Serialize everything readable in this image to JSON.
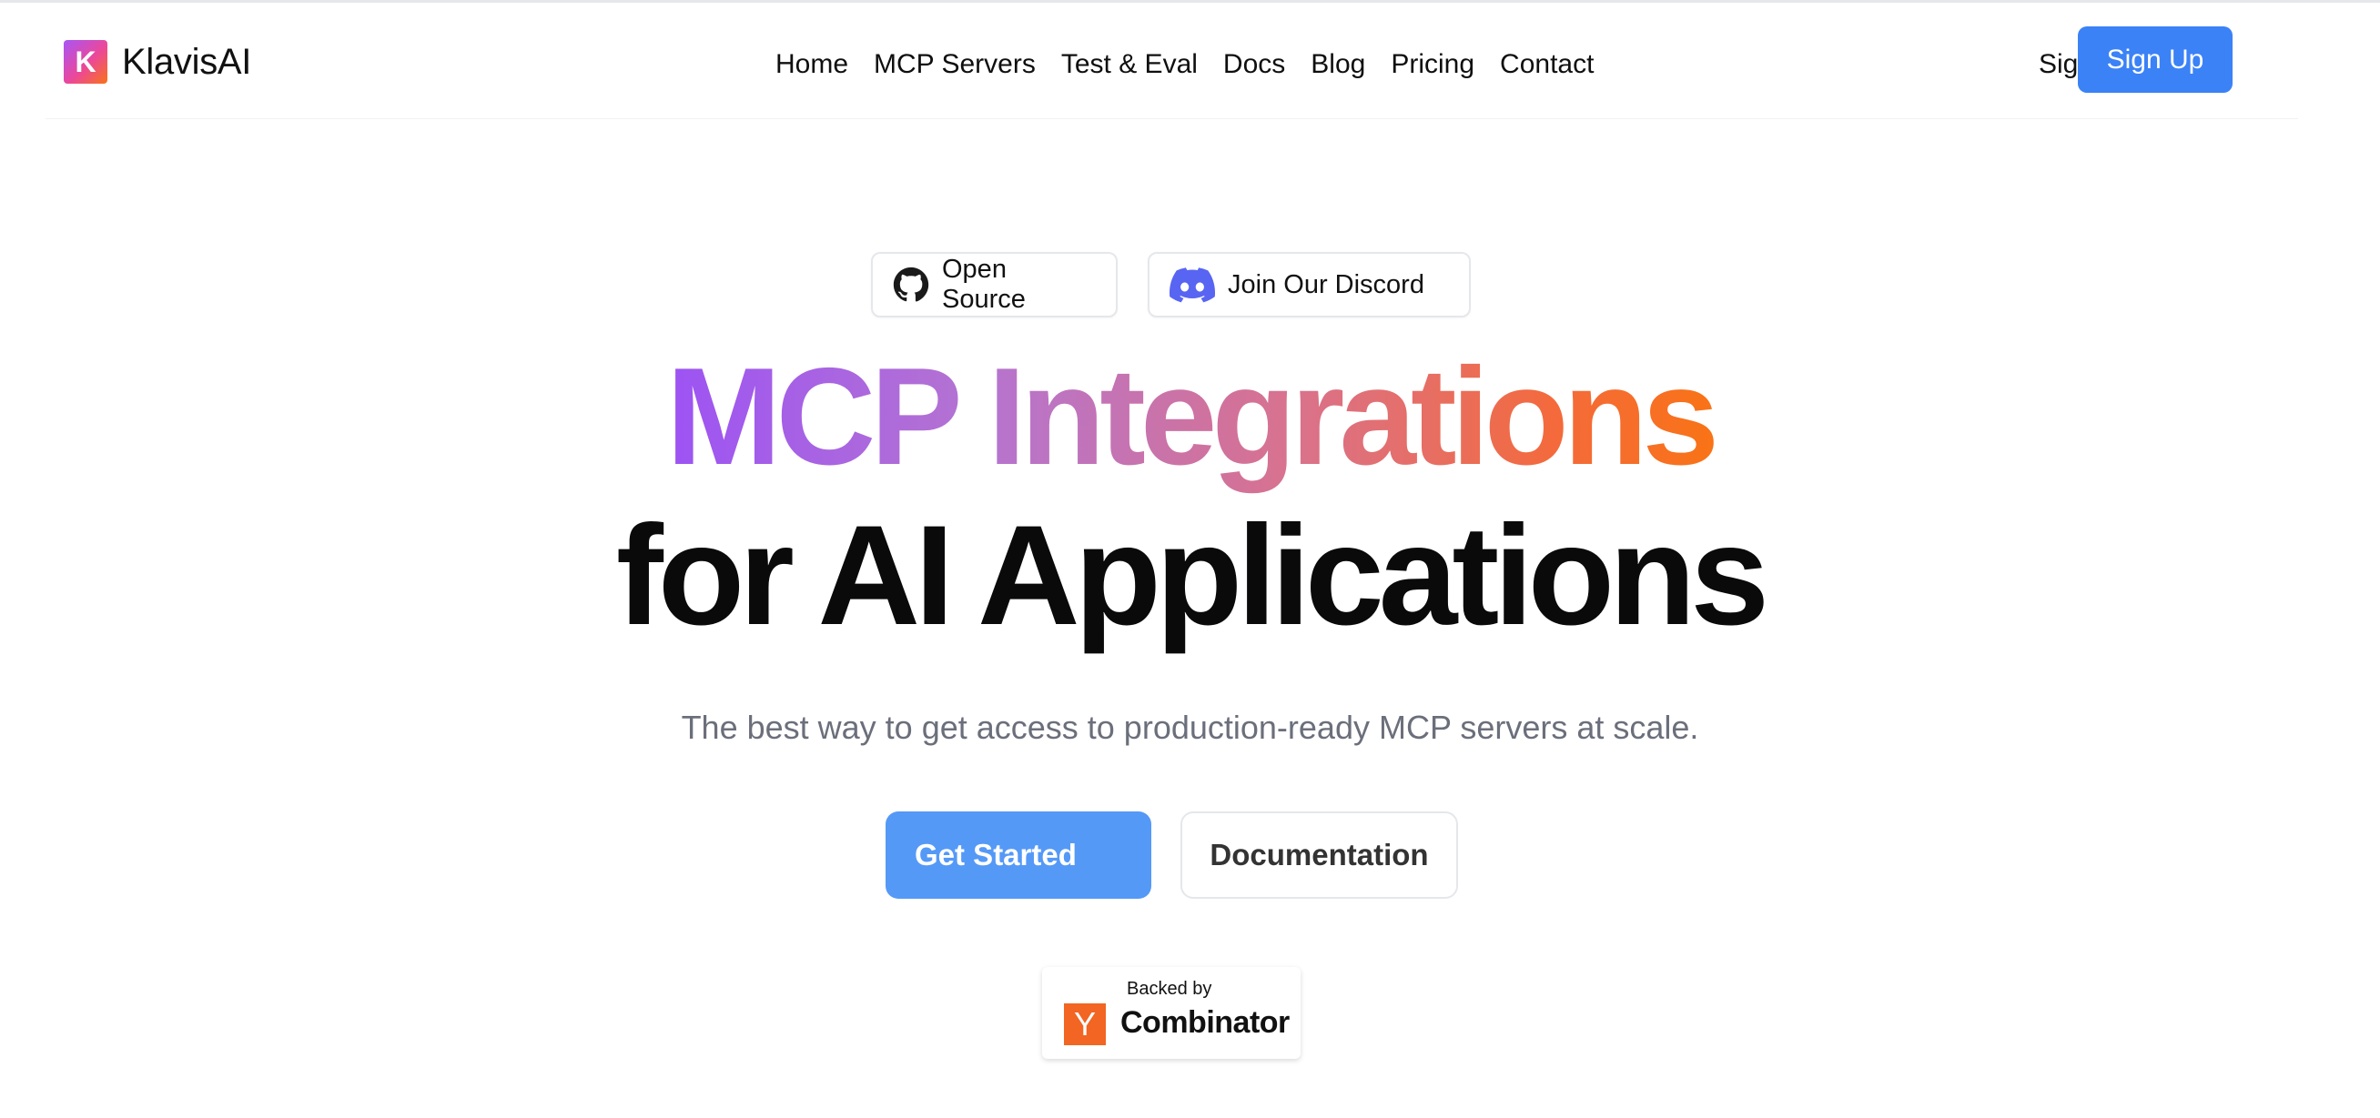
{
  "header": {
    "brand_letter": "K",
    "brand_name": "KlavisAI",
    "nav": [
      "Home",
      "MCP Servers",
      "Test & Eval",
      "Docs",
      "Blog",
      "Pricing",
      "Contact"
    ],
    "sign_in": "Sign In",
    "sign_up": "Sign Up"
  },
  "pills": {
    "open_source": {
      "label": "Open Source",
      "icon": "github-icon"
    },
    "discord": {
      "label": "Join Our Discord",
      "icon": "discord-icon"
    }
  },
  "hero": {
    "line1": "MCP Integrations",
    "line2": "for AI Applications",
    "subtitle": "The best way to get access to production-ready MCP servers at scale."
  },
  "cta": {
    "primary": "Get Started",
    "secondary": "Documentation"
  },
  "badge": {
    "backed_by": "Backed by",
    "logo_letter": "Y",
    "name": "Combinator"
  },
  "colors": {
    "accent": "#3b82f6",
    "cta_primary": "#5599f7",
    "gradient_start": "#9c53f4",
    "gradient_end": "#f97316",
    "discord": "#5865f2",
    "yc_orange": "#f26522"
  }
}
